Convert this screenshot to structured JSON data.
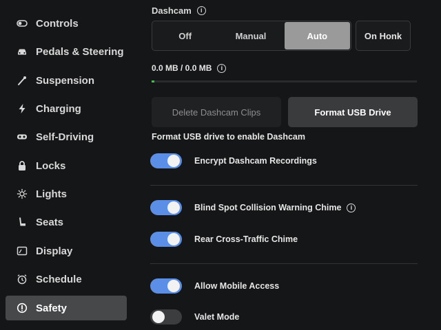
{
  "sidebar": {
    "items": [
      {
        "label": "Controls",
        "icon": "toggle-icon",
        "active": false
      },
      {
        "label": "Pedals & Steering",
        "icon": "car-icon",
        "active": false
      },
      {
        "label": "Suspension",
        "icon": "wrench-icon",
        "active": false
      },
      {
        "label": "Charging",
        "icon": "lightning-icon",
        "active": false
      },
      {
        "label": "Self-Driving",
        "icon": "steering-wheel-icon",
        "active": false
      },
      {
        "label": "Locks",
        "icon": "lock-icon",
        "active": false
      },
      {
        "label": "Lights",
        "icon": "sun-icon",
        "active": false
      },
      {
        "label": "Seats",
        "icon": "seat-icon",
        "active": false
      },
      {
        "label": "Display",
        "icon": "display-icon",
        "active": false
      },
      {
        "label": "Schedule",
        "icon": "alarm-clock-icon",
        "active": false
      },
      {
        "label": "Safety",
        "icon": "info-circle-icon",
        "active": true
      }
    ]
  },
  "dashcam": {
    "label": "Dashcam",
    "options": [
      "Off",
      "Manual",
      "Auto"
    ],
    "selected": "Auto",
    "on_honk": "On Honk",
    "storage": "0.0 MB / 0.0 MB",
    "storage_used_fraction": 0.01,
    "delete_button": "Delete Dashcam Clips",
    "format_button": "Format USB Drive",
    "format_note": "Format USB drive to enable Dashcam"
  },
  "toggles": {
    "encrypt": {
      "label": "Encrypt Dashcam Recordings",
      "on": true
    },
    "blind_spot": {
      "label": "Blind Spot Collision Warning Chime",
      "on": true
    },
    "rear_cross": {
      "label": "Rear Cross-Traffic Chime",
      "on": true
    },
    "mobile_access": {
      "label": "Allow Mobile Access",
      "on": true
    },
    "valet": {
      "label": "Valet Mode",
      "on": false
    }
  },
  "colors": {
    "accent": "#5b8ee6",
    "active_sidebar": "#474849",
    "selected_segment": "#9a9a9a",
    "progress": "#3fbf4a"
  }
}
